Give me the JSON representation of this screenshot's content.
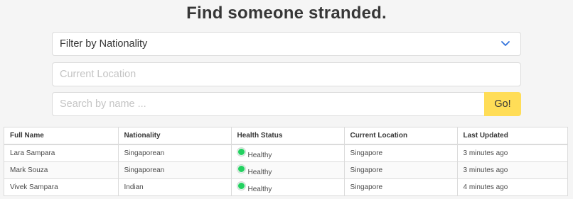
{
  "page": {
    "title": "Find someone stranded."
  },
  "filters": {
    "nationality_select": {
      "value": "Filter by Nationality",
      "icon": "chevron-down-icon",
      "icon_color": "#3273dc"
    },
    "location_input": {
      "value": "",
      "placeholder": "Current Location"
    },
    "search_input": {
      "value": "",
      "placeholder": "Search by name ..."
    },
    "go_button": {
      "label": "Go!",
      "color": "#ffdd57"
    }
  },
  "table": {
    "columns": [
      "Full Name",
      "Nationality",
      "Health Status",
      "Current Location",
      "Last Updated"
    ],
    "rows": [
      {
        "full_name": "Lara Sampara",
        "nationality": "Singaporean",
        "health_status": "Healthy",
        "status_color": "#23d160",
        "current_location": "Singapore",
        "last_updated": "3 minutes ago"
      },
      {
        "full_name": "Mark Souza",
        "nationality": "Singaporean",
        "health_status": "Healthy",
        "status_color": "#23d160",
        "current_location": "Singapore",
        "last_updated": "3 minutes ago"
      },
      {
        "full_name": "Vivek Sampara",
        "nationality": "Indian",
        "health_status": "Healthy",
        "status_color": "#23d160",
        "current_location": "Singapore",
        "last_updated": "4 minutes ago"
      }
    ]
  }
}
